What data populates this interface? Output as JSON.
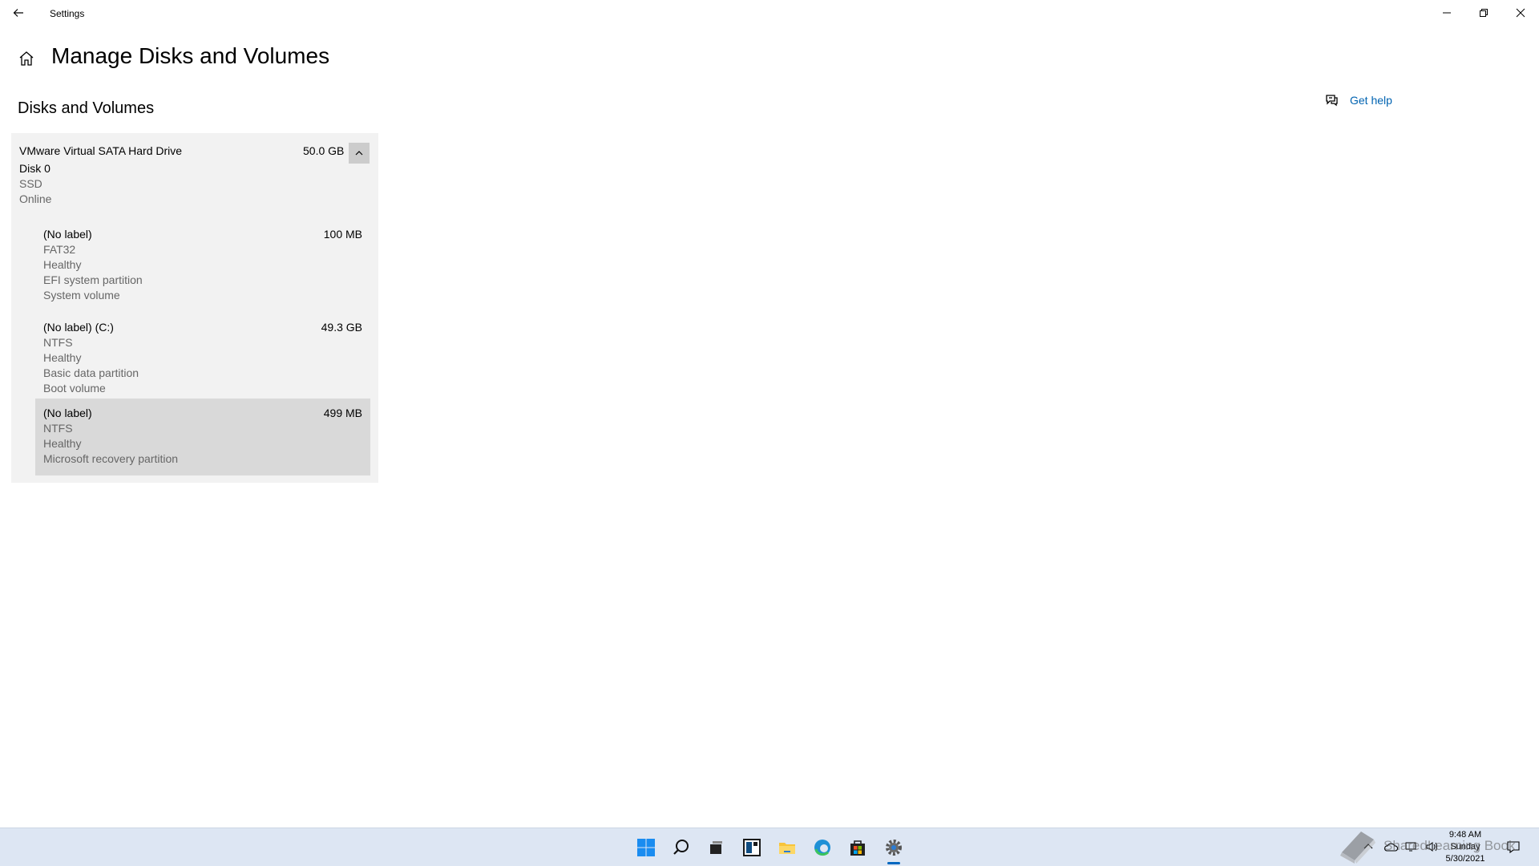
{
  "window": {
    "title": "Settings"
  },
  "page": {
    "title": "Manage Disks and Volumes",
    "section_title": "Disks and Volumes",
    "get_help": "Get help"
  },
  "disk": {
    "name": "VMware Virtual SATA Hard Drive",
    "size": "50.0 GB",
    "id": "Disk 0",
    "type": "SSD",
    "status": "Online",
    "volumes": [
      {
        "label": "(No label)",
        "size": "100 MB",
        "lines": [
          "FAT32",
          "Healthy",
          "EFI system partition",
          "System volume"
        ]
      },
      {
        "label": "(No label) (C:)",
        "size": "49.3 GB",
        "lines": [
          "NTFS",
          "Healthy",
          "Basic data partition",
          "Boot volume"
        ]
      },
      {
        "label": "(No label)",
        "size": "499 MB",
        "lines": [
          "NTFS",
          "Healthy",
          "Microsoft recovery partition"
        ],
        "selected": true
      }
    ]
  },
  "taskbar": {
    "apps": [
      "start-icon",
      "search-icon",
      "task-view-icon",
      "widgets-icon",
      "file-explorer-icon",
      "edge-icon",
      "store-icon",
      "settings-icon"
    ],
    "clock": {
      "time": "9:48 AM",
      "day": "Sunday",
      "date": "5/30/2021"
    }
  },
  "watermark": {
    "text": "SharedLearning Book"
  },
  "colors": {
    "accent": "#0063b1",
    "panel_bg": "#f2f2f2",
    "selected_bg": "#d9d9d9",
    "taskbar_bg": "#dde6f3"
  }
}
